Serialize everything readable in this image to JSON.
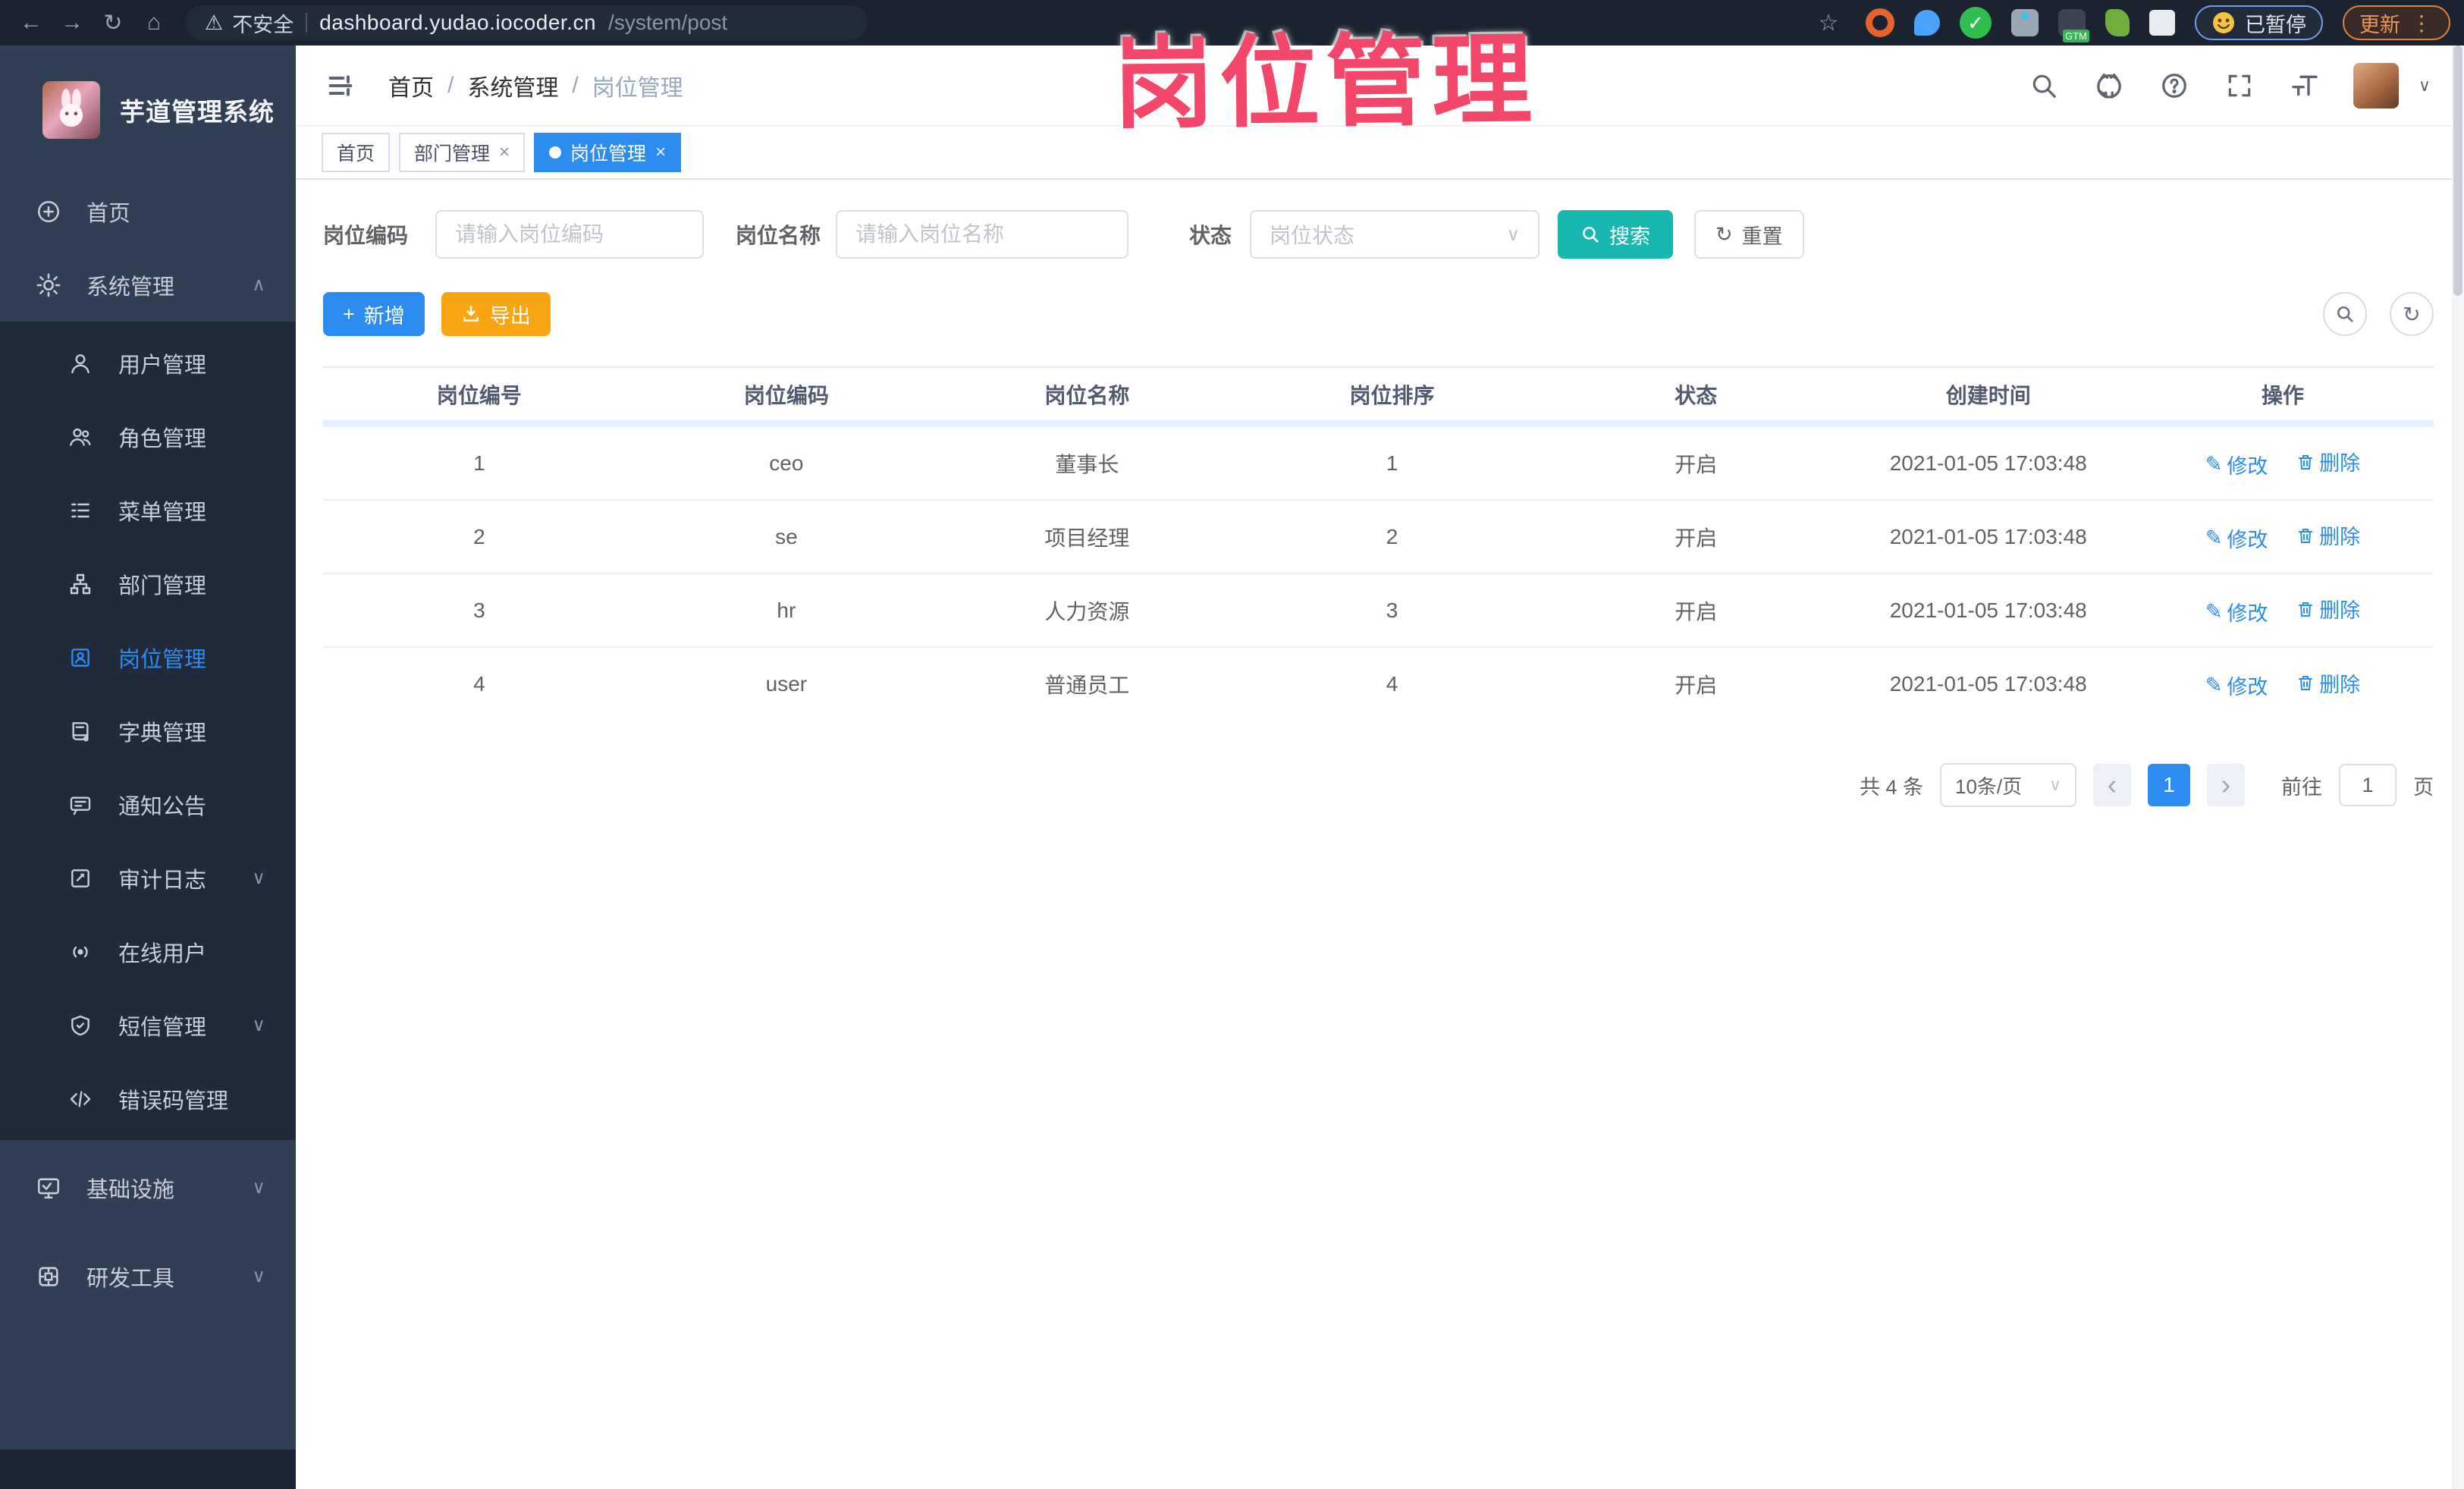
{
  "browser": {
    "security": "不安全",
    "host": "dashboard.yudao.iocoder.cn",
    "path": "/system/post",
    "paused_label": "已暂停",
    "update_label": "更新"
  },
  "glyphs": {
    "back": "←",
    "forward": "→",
    "refresh": "↻",
    "home": "⌂",
    "star": "☆",
    "warning": "⚠",
    "menu_dots": "⋮",
    "chevron_up": "∧",
    "chevron_down": "∨",
    "close": "×",
    "caret": "∨",
    "prev": "‹",
    "next": "›",
    "plus": "+",
    "edit": "✎"
  },
  "watermark": {
    "text": "岗位管理",
    "color": "#f2476a"
  },
  "sidebar": {
    "title": "芋道管理系统",
    "home": "首页",
    "system": "系统管理",
    "system_children": [
      "用户管理",
      "角色管理",
      "菜单管理",
      "部门管理",
      "岗位管理",
      "字典管理",
      "通知公告",
      "审计日志",
      "在线用户",
      "短信管理",
      "错误码管理"
    ],
    "infra": "基础设施",
    "devtool": "研发工具"
  },
  "breadcrumb": {
    "items": [
      "首页",
      "系统管理",
      "岗位管理"
    ],
    "separator": "/"
  },
  "tabs": {
    "items": [
      {
        "label": "首页"
      },
      {
        "label": "部门管理"
      },
      {
        "label": "岗位管理"
      }
    ]
  },
  "filters": {
    "code_label": "岗位编码",
    "code_placeholder": "请输入岗位编码",
    "name_label": "岗位名称",
    "name_placeholder": "请输入岗位名称",
    "status_label": "状态",
    "status_placeholder": "岗位状态",
    "search_label": "搜索",
    "reset_label": "重置"
  },
  "toolbar": {
    "add_label": "新增",
    "export_label": "导出"
  },
  "table": {
    "columns": [
      "岗位编号",
      "岗位编码",
      "岗位名称",
      "岗位排序",
      "状态",
      "创建时间",
      "操作"
    ],
    "rows": [
      {
        "id": "1",
        "code": "ceo",
        "name": "董事长",
        "sort": "1",
        "status": "开启",
        "created": "2021-01-05 17:03:48"
      },
      {
        "id": "2",
        "code": "se",
        "name": "项目经理",
        "sort": "2",
        "status": "开启",
        "created": "2021-01-05 17:03:48"
      },
      {
        "id": "3",
        "code": "hr",
        "name": "人力资源",
        "sort": "3",
        "status": "开启",
        "created": "2021-01-05 17:03:48"
      },
      {
        "id": "4",
        "code": "user",
        "name": "普通员工",
        "sort": "4",
        "status": "开启",
        "created": "2021-01-05 17:03:48"
      }
    ],
    "edit_label": "修改",
    "delete_label": "删除"
  },
  "pagination": {
    "total": "共 4 条",
    "page_size": "10条/页",
    "current": "1",
    "goto_label": "前往",
    "goto_value": "1",
    "unit_label": "页"
  },
  "colors": {
    "primary_blue": "#2d8cf0",
    "search_teal": "#18b8b0",
    "export_amber": "#f9a412",
    "watermark_pink": "#f2476a",
    "sidebar_bg": "#313f55",
    "submenu_bg": "#1f2b3a",
    "chrome_bg": "#1b2330"
  }
}
